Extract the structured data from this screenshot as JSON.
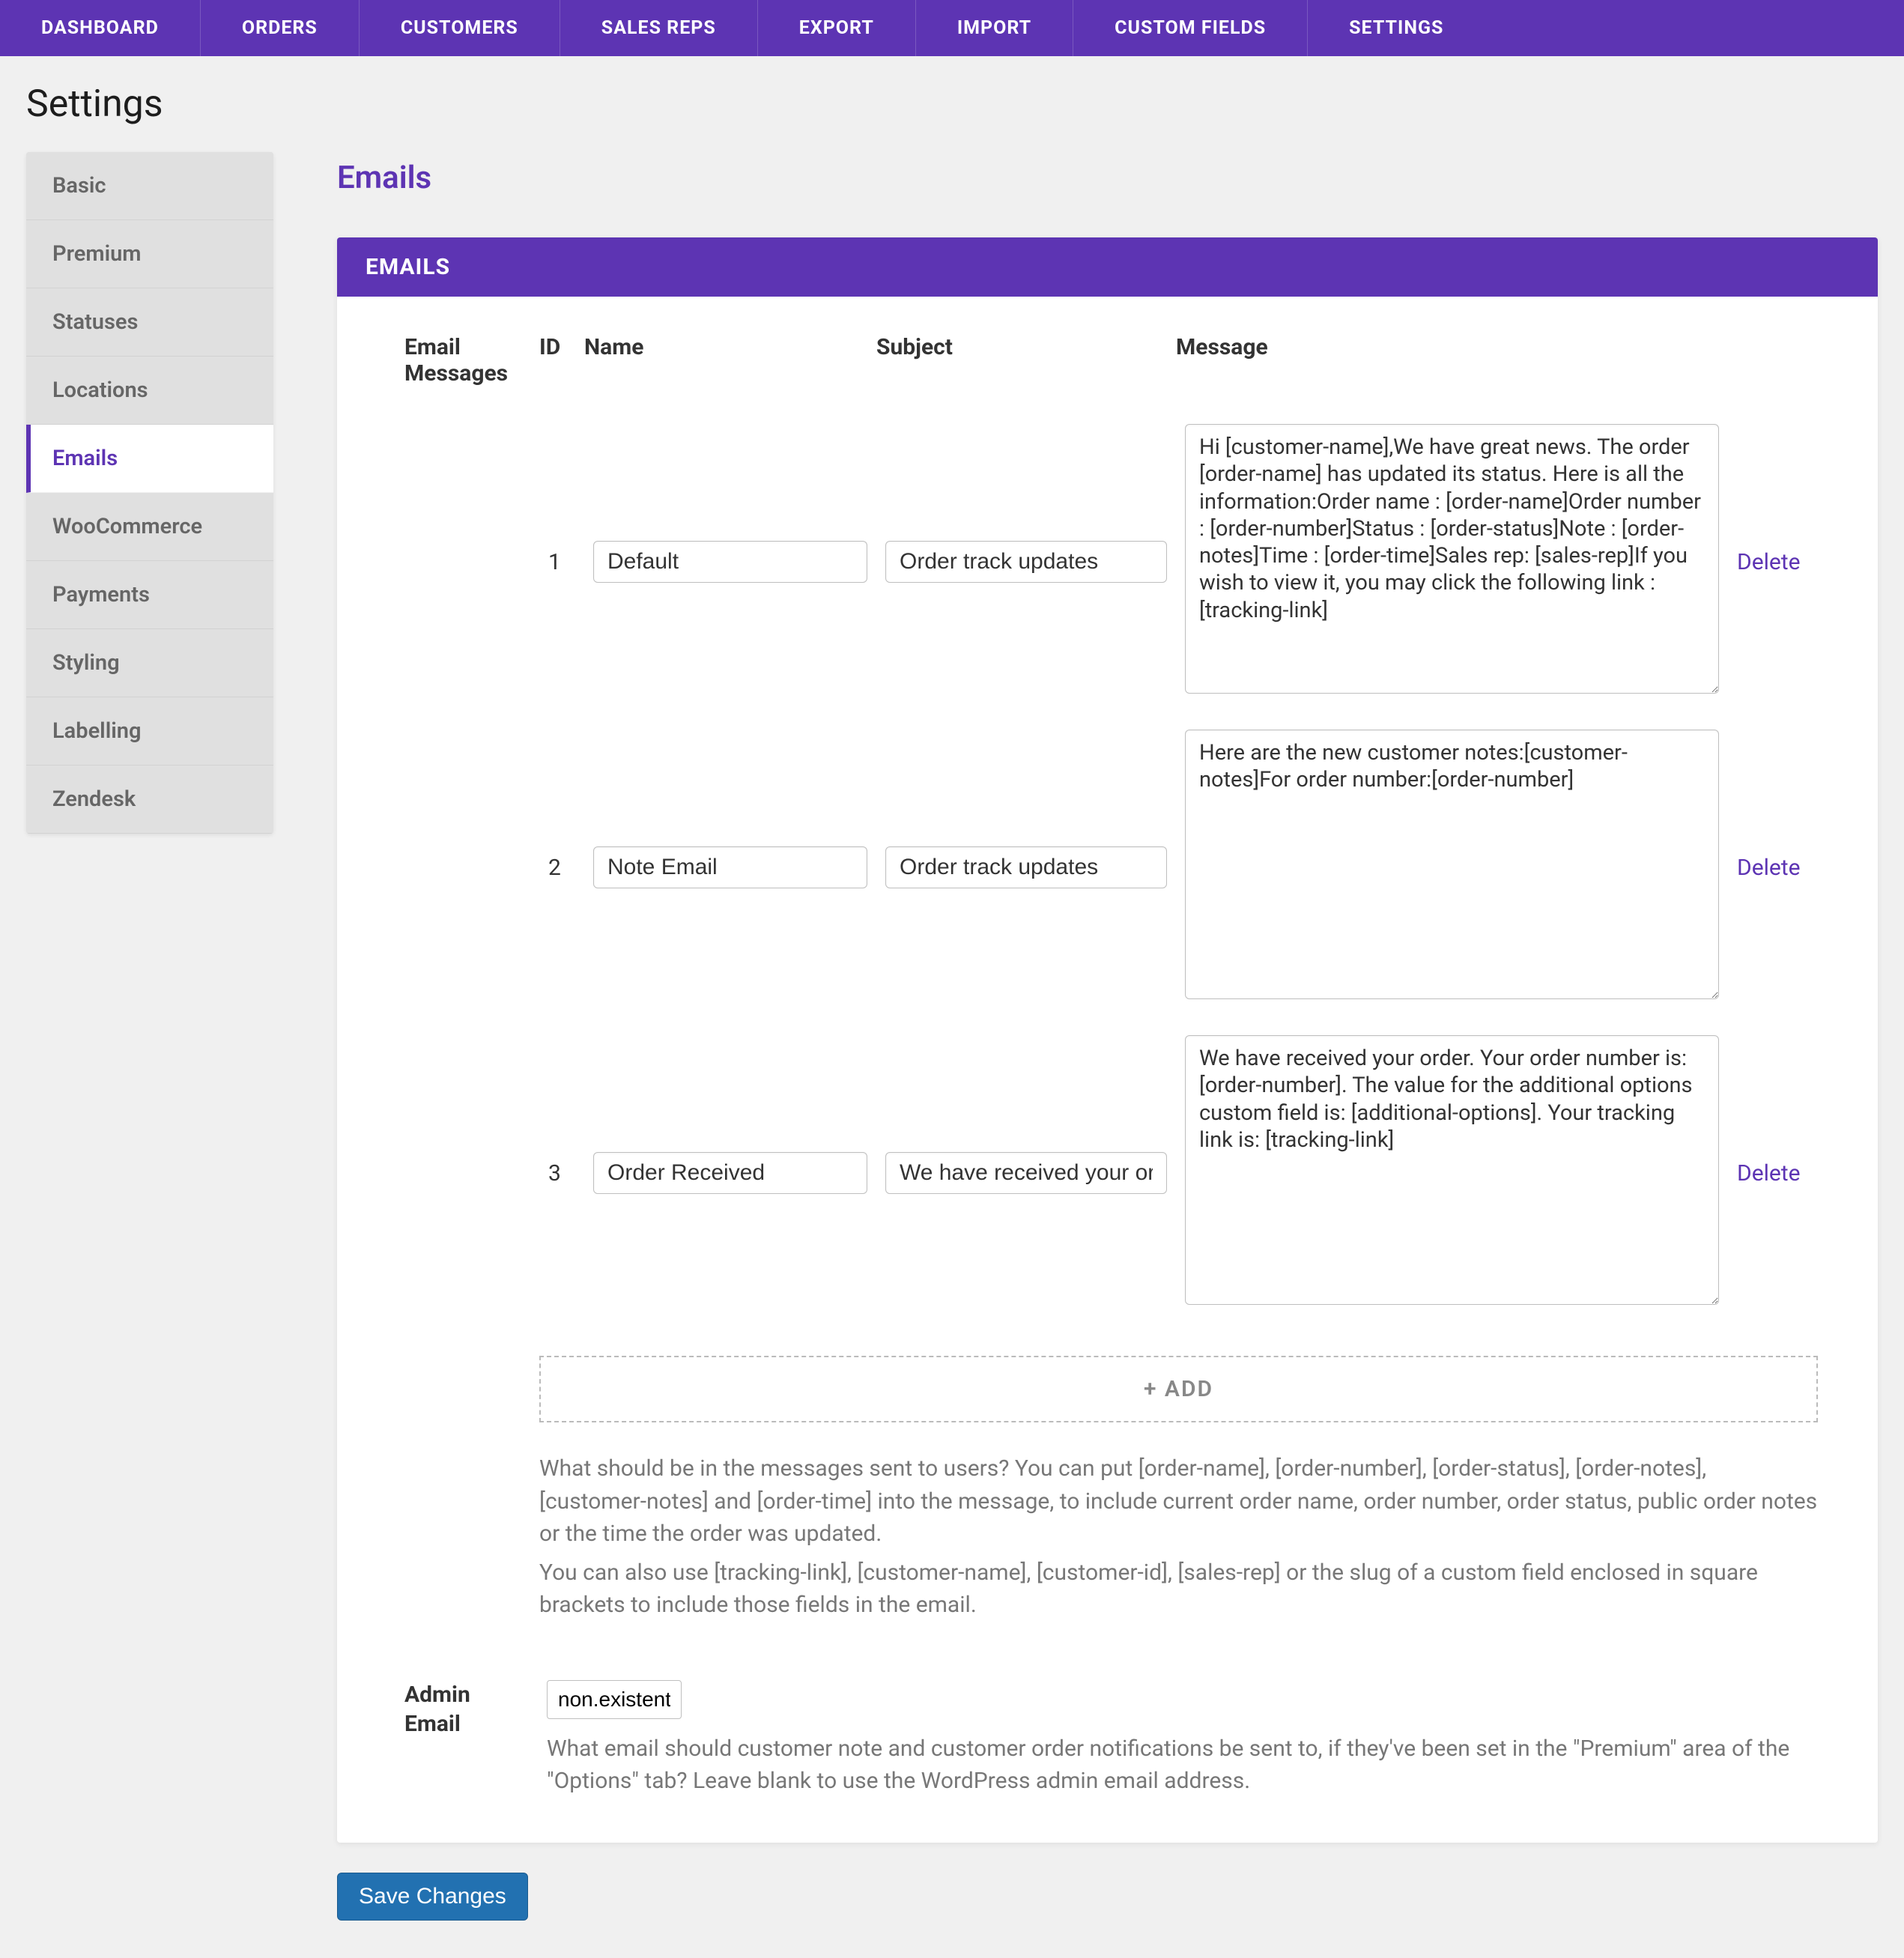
{
  "topnav": [
    "Dashboard",
    "Orders",
    "Customers",
    "Sales Reps",
    "Export",
    "Import",
    "Custom Fields",
    "Settings"
  ],
  "page_title": "Settings",
  "sidebar": {
    "items": [
      "Basic",
      "Premium",
      "Statuses",
      "Locations",
      "Emails",
      "WooCommerce",
      "Payments",
      "Styling",
      "Labelling",
      "Zendesk"
    ],
    "active_index": 4
  },
  "content": {
    "title": "Emails",
    "panel_header": "Emails",
    "email_messages_label": "Email Messages",
    "columns": {
      "id": "ID",
      "name": "Name",
      "subject": "Subject",
      "message": "Message"
    },
    "rows": [
      {
        "id": "1",
        "name": "Default",
        "subject": "Order track updates",
        "message": "Hi [customer-name],We have great news. The order [order-name] has updated its status. Here is all the information:Order name : [order-name]Order number : [order-number]Status : [order-status]Note : [order-notes]Time : [order-time]Sales rep: [sales-rep]If you wish to view it, you may click the following link : [tracking-link]",
        "action": "Delete"
      },
      {
        "id": "2",
        "name": "Note Email",
        "subject": "Order track updates",
        "message": "Here are the new customer notes:[customer-notes]For order number:[order-number]",
        "action": "Delete"
      },
      {
        "id": "3",
        "name": "Order Received",
        "subject": "We have received your order!",
        "message": "We have received your order. Your order number is: [order-number]. The value for the additional options custom field is: [additional-options]. Your tracking link is: [tracking-link]",
        "action": "Delete"
      }
    ],
    "add_label": "+ ADD",
    "help1": "What should be in the messages sent to users? You can put [order-name], [order-number], [order-status], [order-notes], [customer-notes] and [order-time] into the message, to include current order name, order number, order status, public order notes or the time the order was updated.",
    "help2": "You can also use [tracking-link], [customer-name], [customer-id], [sales-rep] or the slug of a custom field enclosed in square brackets to include those fields in the email.",
    "admin_email_label": "Admin Email",
    "admin_email_value": "non.existentemail@test.com",
    "admin_email_help": "What email should customer note and customer order notifications be sent to, if they've been set in the \"Premium\" area of the \"Options\" tab? Leave blank to use the WordPress admin email address.",
    "save_label": "Save Changes"
  }
}
